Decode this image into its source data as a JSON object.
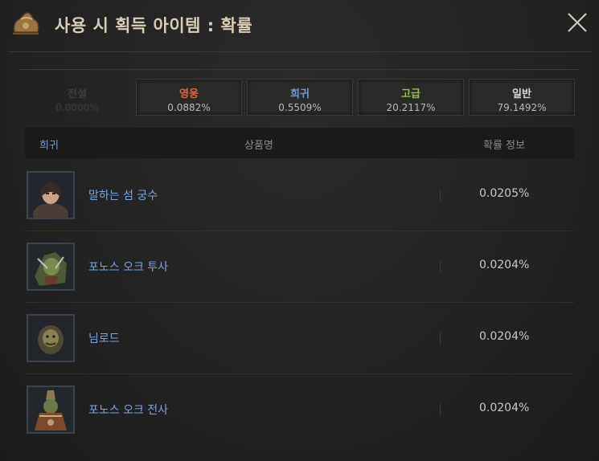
{
  "title": "사용 시 획득 아이템 : 확률",
  "tabs": [
    {
      "label": "전설",
      "value": "0.0000%",
      "color": "#3e3e3e",
      "enabled": false
    },
    {
      "label": "영웅",
      "value": "0.0882%",
      "color": "#e2643f",
      "enabled": true
    },
    {
      "label": "희귀",
      "value": "0.5509%",
      "color": "#6f99d8",
      "enabled": true
    },
    {
      "label": "고급",
      "value": "20.2117%",
      "color": "#8cc24a",
      "enabled": true
    },
    {
      "label": "일반",
      "value": "79.1492%",
      "color": "#d8d8d8",
      "enabled": true
    }
  ],
  "table": {
    "selected_grade": "희귀",
    "col_name": "상품명",
    "col_prob": "확률 정보",
    "rows": [
      {
        "name": "말하는 섬 궁수",
        "prob": "0.0205%",
        "icon": "archer-portrait-icon"
      },
      {
        "name": "포노스 오크 투사",
        "prob": "0.0204%",
        "icon": "orc-fighter-portrait-icon"
      },
      {
        "name": "님로드",
        "prob": "0.0204%",
        "icon": "nimrod-portrait-icon"
      },
      {
        "name": "포노스 오크 전사",
        "prob": "0.0204%",
        "icon": "orc-warrior-portrait-icon"
      }
    ]
  },
  "icons": {
    "title": "item-bag-icon",
    "close": "close-icon"
  },
  "colors": {
    "title_text": "#d9cdb5",
    "item_name": "#7ba4e0"
  }
}
